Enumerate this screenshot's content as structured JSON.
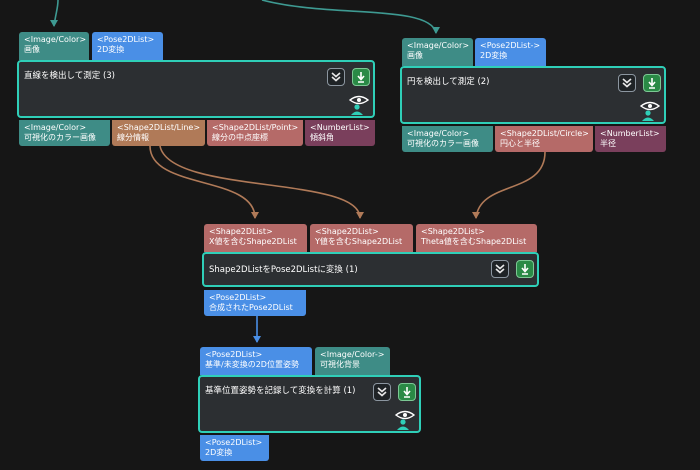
{
  "colors": {
    "node_border": "#2fcfb8",
    "node_bg": "#2c2f32",
    "wire_teal": "#3e9a92",
    "wire_brown": "#b07a58",
    "wire_blue": "#4a8fe6"
  },
  "nodes": [
    {
      "title": "直線を検出して測定 (3)",
      "inputs": [
        {
          "type": "<Image/Color>",
          "label": "画像"
        },
        {
          "type": "<Pose2DList>",
          "label": "2D変換"
        }
      ],
      "outputs": [
        {
          "type": "<Image/Color>",
          "label": "可視化のカラー画像"
        },
        {
          "type": "<Shape2DList/Line>",
          "label": "線分情報"
        },
        {
          "type": "<Shape2DList/Point>",
          "label": "線分の中点座標"
        },
        {
          "type": "<NumberList>",
          "label": "傾斜角"
        }
      ],
      "icons": [
        "step-into-icon",
        "download-icon",
        "visibility-icon"
      ]
    },
    {
      "title": "円を検出して測定 (2)",
      "inputs": [
        {
          "type": "<Image/Color>",
          "label": "画像"
        },
        {
          "type": "<Pose2DList->",
          "label": "2D変換"
        }
      ],
      "outputs": [
        {
          "type": "<Image/Color>",
          "label": "可視化のカラー画像"
        },
        {
          "type": "<Shape2DList/Circle>",
          "label": "円心と半径"
        },
        {
          "type": "<NumberList>",
          "label": "半径"
        }
      ],
      "icons": [
        "step-into-icon",
        "download-icon",
        "visibility-icon"
      ]
    },
    {
      "title": "Shape2DListをPose2DListに変換 (1)",
      "inputs": [
        {
          "type": "<Shape2DList>",
          "label": "X値を含むShape2DList"
        },
        {
          "type": "<Shape2DList>",
          "label": "Y値を含むShape2DList"
        },
        {
          "type": "<Shape2DList>",
          "label": "Theta値を含むShape2DList"
        }
      ],
      "outputs": [
        {
          "type": "<Pose2DList>",
          "label": "合成されたPose2DList"
        }
      ],
      "icons": [
        "step-into-icon",
        "download-icon"
      ]
    },
    {
      "title": "基準位置姿勢を記録して変換を計算 (1)",
      "inputs": [
        {
          "type": "<Pose2DList>",
          "label": "基準/未変換の2D位置姿勢"
        },
        {
          "type": "<Image/Color->",
          "label": "可視化背景"
        }
      ],
      "outputs": [
        {
          "type": "<Pose2DList>",
          "label": "2D変換"
        }
      ],
      "icons": [
        "step-into-icon",
        "download-icon",
        "visibility-icon"
      ]
    }
  ]
}
